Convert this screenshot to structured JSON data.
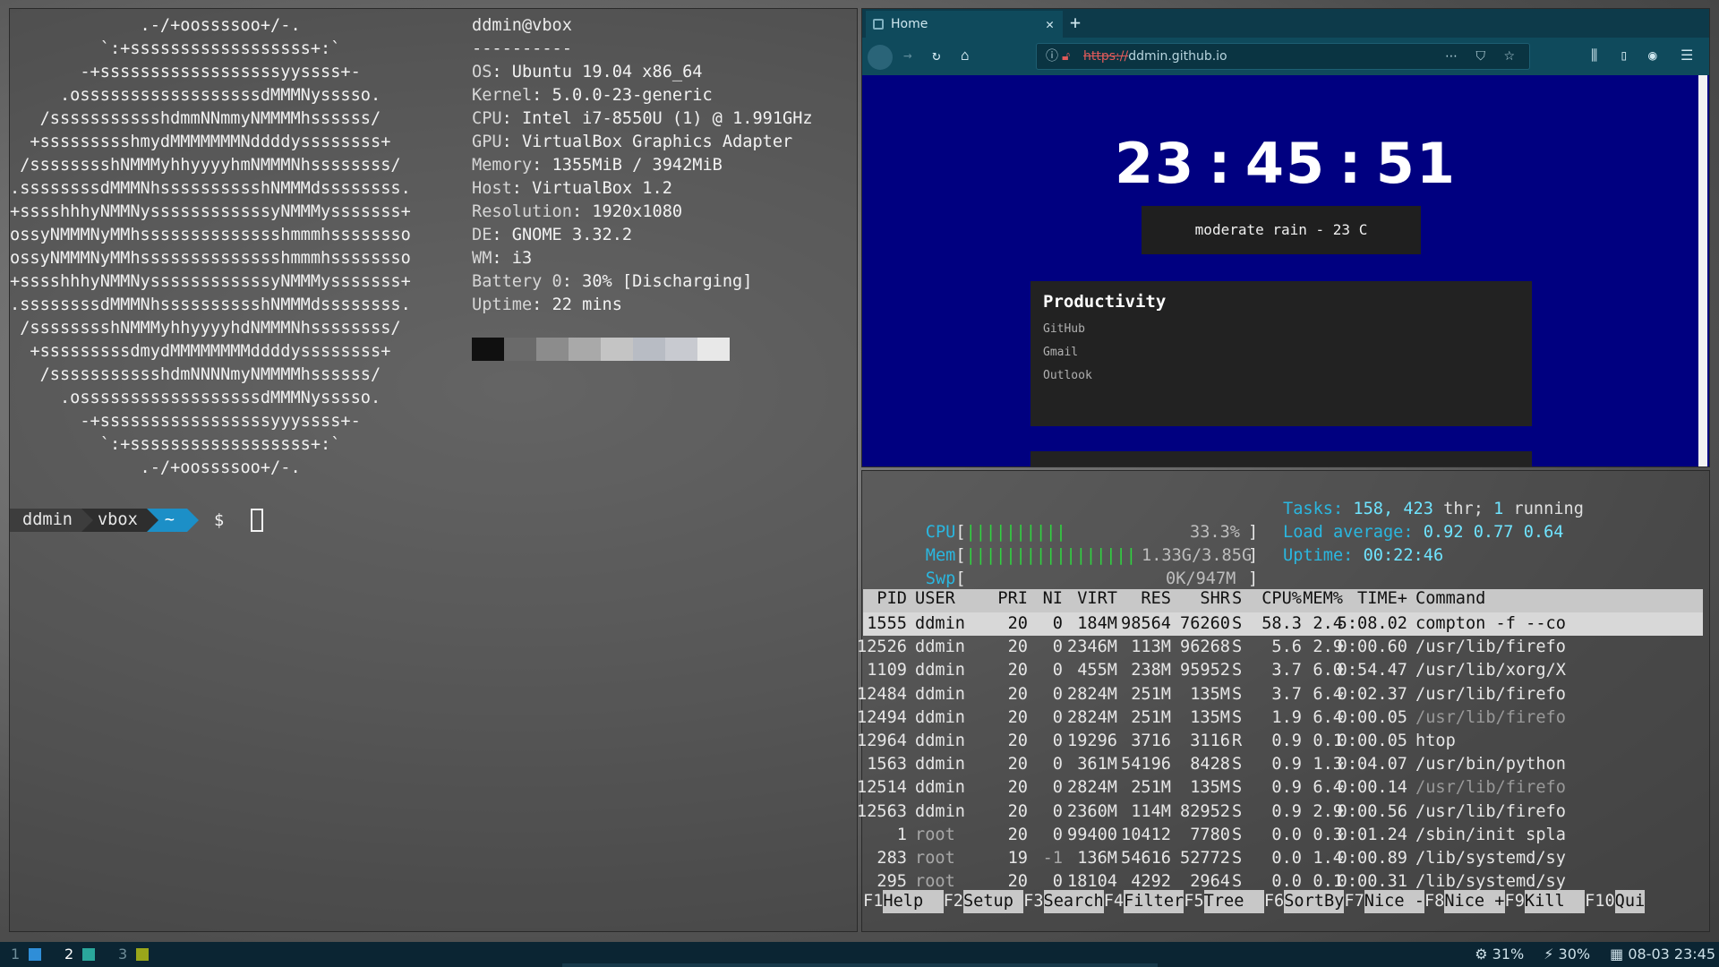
{
  "neofetch": {
    "logo_lines": [
      "             .-/+oossssoo+/-.",
      "         `:+ssssssssssssssssss+:`",
      "       -+ssssssssssssssssssyyssss+-",
      "     .ossssssssssssssssssdMMMNysssso.",
      "   /ssssssssssshdmmNNmmyNMMMMhssssss/",
      "  +ssssssssshmydMMMMMMMNddddyssssssss+",
      " /sssssssshNMMMyhhyyyyhmNMMMNhssssssss/",
      ".ssssssssdMMMNhsssssssssshNMMMdssssssss.",
      "+sssshhhyNMMNyssssssssssssyNMMMysssssss+",
      "ossyNMMMNyMMhsssssssssssssshmmmhssssssso",
      "ossyNMMMNyMMhsssssssssssssshmmmhssssssso",
      "+sssshhhyNMMNyssssssssssssyNMMMysssssss+",
      ".ssssssssdMMMNhsssssssssshNMMMdssssssss.",
      " /sssssssshNMMMyhhyyyyhdNMMMNhssssssss/",
      "  +sssssssssdmydMMMMMMMMddddyssssssss+",
      "   /ssssssssssshdmNNNNmyNMMMMhssssss/",
      "     .ossssssssssssssssssdMMMNysssso.",
      "       -+sssssssssssssssssyyyssss+-",
      "         `:+ssssssssssssssssss+:`",
      "             .-/+oossssoo+/-."
    ],
    "user_host": "ddmin@vbox",
    "separator": "----------",
    "info": [
      {
        "key": "OS",
        "value": "Ubuntu 19.04 x86_64"
      },
      {
        "key": "Kernel",
        "value": "5.0.0-23-generic"
      },
      {
        "key": "CPU",
        "value": "Intel i7-8550U (1) @ 1.991GHz"
      },
      {
        "key": "GPU",
        "value": "VirtualBox Graphics Adapter"
      },
      {
        "key": "Memory",
        "value": "1355MiB / 3942MiB"
      },
      {
        "key": "Host",
        "value": "VirtualBox 1.2"
      },
      {
        "key": "Resolution",
        "value": "1920x1080"
      },
      {
        "key": "DE",
        "value": "GNOME 3.32.2"
      },
      {
        "key": "WM",
        "value": "i3"
      },
      {
        "key": "Battery 0",
        "value": "30% [Discharging]"
      },
      {
        "key": "Uptime",
        "value": "22 mins"
      }
    ],
    "palette": [
      "#101010",
      "#6a6a6a",
      "#8c8c8c",
      "#a9a9a9",
      "#c4c4c4",
      "#b8bcc4",
      "#c8cad0",
      "#e8e8e8"
    ]
  },
  "prompt": {
    "user": "ddmin",
    "host": "vbox",
    "dir": "~",
    "symbol": "$"
  },
  "firefox": {
    "tab_title": "Home",
    "url_scheme": "https://",
    "url_host": "ddmin.github.io",
    "page": {
      "clock": "23:45:51",
      "weather": "moderate rain - 23 C",
      "card_title": "Productivity",
      "links": [
        "GitHub",
        "Gmail",
        "Outlook"
      ]
    }
  },
  "htop": {
    "cpu_label": "CPU",
    "cpu_bar": "||||||||||",
    "cpu_value": "33.3%",
    "mem_label": "Mem",
    "mem_bar": "|||||||||||||||||",
    "mem_value": "1.33G/3.85G",
    "swp_label": "Swp",
    "swp_value": "0K/947M",
    "tasks_label": "Tasks:",
    "tasks_value": "158,",
    "thr_value": "423",
    "thr_label": "thr;",
    "running_value": "1",
    "running_label": "running",
    "load_label": "Load average:",
    "load_1": "0.92",
    "load_5": "0.77",
    "load_15": "0.64",
    "uptime_label": "Uptime:",
    "uptime_value": "00:22:46",
    "columns": [
      "PID",
      "USER",
      "PRI",
      "NI",
      "VIRT",
      "RES",
      "SHR",
      "S",
      "CPU%",
      "MEM%",
      "TIME+",
      "Command"
    ],
    "processes": [
      [
        "1555",
        "ddmin",
        "20",
        "0",
        "184M",
        "98564",
        "76260",
        "S",
        "58.3",
        "2.4",
        "5:08.02",
        "compton -f --co"
      ],
      [
        "12526",
        "ddmin",
        "20",
        "0",
        "2346M",
        "113M",
        "96268",
        "S",
        "5.6",
        "2.9",
        "0:00.60",
        "/usr/lib/firefo"
      ],
      [
        "1109",
        "ddmin",
        "20",
        "0",
        "455M",
        "238M",
        "95952",
        "S",
        "3.7",
        "6.0",
        "0:54.47",
        "/usr/lib/xorg/X"
      ],
      [
        "12484",
        "ddmin",
        "20",
        "0",
        "2824M",
        "251M",
        "135M",
        "S",
        "3.7",
        "6.4",
        "0:02.37",
        "/usr/lib/firefo"
      ],
      [
        "12494",
        "ddmin",
        "20",
        "0",
        "2824M",
        "251M",
        "135M",
        "S",
        "1.9",
        "6.4",
        "0:00.05",
        "/usr/lib/firefo"
      ],
      [
        "12964",
        "ddmin",
        "20",
        "0",
        "19296",
        "3716",
        "3116",
        "R",
        "0.9",
        "0.1",
        "0:00.05",
        "htop"
      ],
      [
        "1563",
        "ddmin",
        "20",
        "0",
        "361M",
        "54196",
        "8428",
        "S",
        "0.9",
        "1.3",
        "0:04.07",
        "/usr/bin/python"
      ],
      [
        "12514",
        "ddmin",
        "20",
        "0",
        "2824M",
        "251M",
        "135M",
        "S",
        "0.9",
        "6.4",
        "0:00.14",
        "/usr/lib/firefo"
      ],
      [
        "12563",
        "ddmin",
        "20",
        "0",
        "2360M",
        "114M",
        "82952",
        "S",
        "0.9",
        "2.9",
        "0:00.56",
        "/usr/lib/firefo"
      ],
      [
        "1",
        "root",
        "20",
        "0",
        "99400",
        "10412",
        "7780",
        "S",
        "0.0",
        "0.3",
        "0:01.24",
        "/sbin/init spla"
      ],
      [
        "283",
        "root",
        "19",
        "-1",
        "136M",
        "54616",
        "52772",
        "S",
        "0.0",
        "1.4",
        "0:00.89",
        "/lib/systemd/sy"
      ],
      [
        "295",
        "root",
        "20",
        "0",
        "18104",
        "4292",
        "2964",
        "S",
        "0.0",
        "0.1",
        "0:00.31",
        "/lib/systemd/sy"
      ]
    ],
    "fkeys": [
      {
        "key": "F1",
        "label": "Help  "
      },
      {
        "key": "F2",
        "label": "Setup "
      },
      {
        "key": "F3",
        "label": "Search"
      },
      {
        "key": "F4",
        "label": "Filter"
      },
      {
        "key": "F5",
        "label": "Tree  "
      },
      {
        "key": "F6",
        "label": "SortBy"
      },
      {
        "key": "F7",
        "label": "Nice -"
      },
      {
        "key": "F8",
        "label": "Nice +"
      },
      {
        "key": "F9",
        "label": "Kill  "
      },
      {
        "key": "F10",
        "label": "Qui"
      }
    ]
  },
  "i3bar": {
    "workspaces": [
      {
        "num": "1",
        "color": "#2f8ed8"
      },
      {
        "num": "2",
        "color": "#2aa79b"
      },
      {
        "num": "3",
        "color": "#9aa61a"
      }
    ],
    "cpu": "31%",
    "battery": "30%",
    "datetime": "08-03 23:45"
  }
}
